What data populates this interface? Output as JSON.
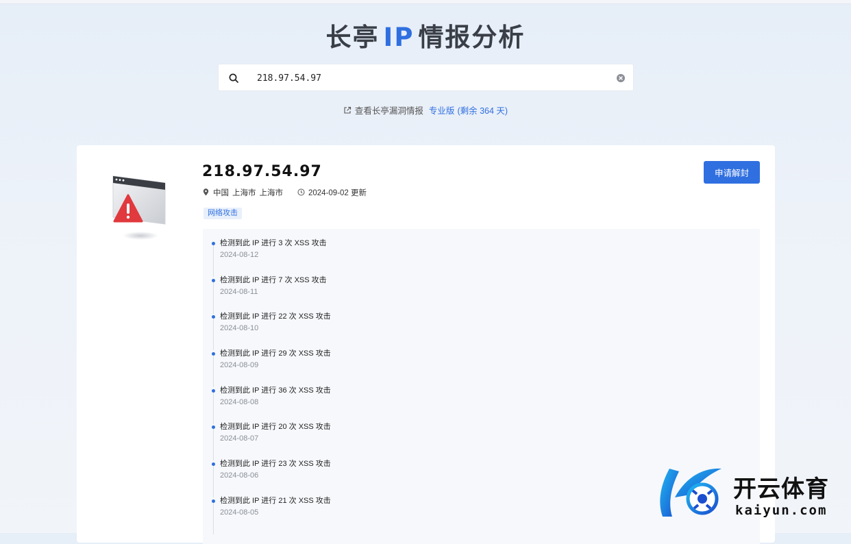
{
  "header": {
    "title_pre": "长亭",
    "title_ip": "IP",
    "title_post": "情报分析"
  },
  "search": {
    "value": "218.97.54.97",
    "icon": "search-icon",
    "clear_icon": "clear-icon"
  },
  "vuln_link": {
    "icon": "external-link-icon",
    "label": "查看长亭漏洞情报",
    "plan": "专业版",
    "remaining": "(剩余 364 天)"
  },
  "result": {
    "ip": "218.97.54.97",
    "location": [
      "中国",
      "上海市",
      "上海市"
    ],
    "updated": "2024-09-02 更新",
    "tag": "网络攻击",
    "unblock_label": "申请解封",
    "events": [
      {
        "desc": "检测到此 IP 进行 3 次 XSS 攻击",
        "date": "2024-08-12"
      },
      {
        "desc": "检测到此 IP 进行 7 次 XSS 攻击",
        "date": "2024-08-11"
      },
      {
        "desc": "检测到此 IP 进行 22 次 XSS 攻击",
        "date": "2024-08-10"
      },
      {
        "desc": "检测到此 IP 进行 29 次 XSS 攻击",
        "date": "2024-08-09"
      },
      {
        "desc": "检测到此 IP 进行 36 次 XSS 攻击",
        "date": "2024-08-08"
      },
      {
        "desc": "检测到此 IP 进行 20 次 XSS 攻击",
        "date": "2024-08-07"
      },
      {
        "desc": "检测到此 IP 进行 23 次 XSS 攻击",
        "date": "2024-08-06"
      },
      {
        "desc": "检测到此 IP 进行 21 次 XSS 攻击",
        "date": "2024-08-05"
      }
    ]
  },
  "watermark": {
    "cn": "开云体育",
    "en": "kaiyun.com"
  },
  "colors": {
    "accent": "#2f6fe0",
    "warning": "#e0393e"
  }
}
